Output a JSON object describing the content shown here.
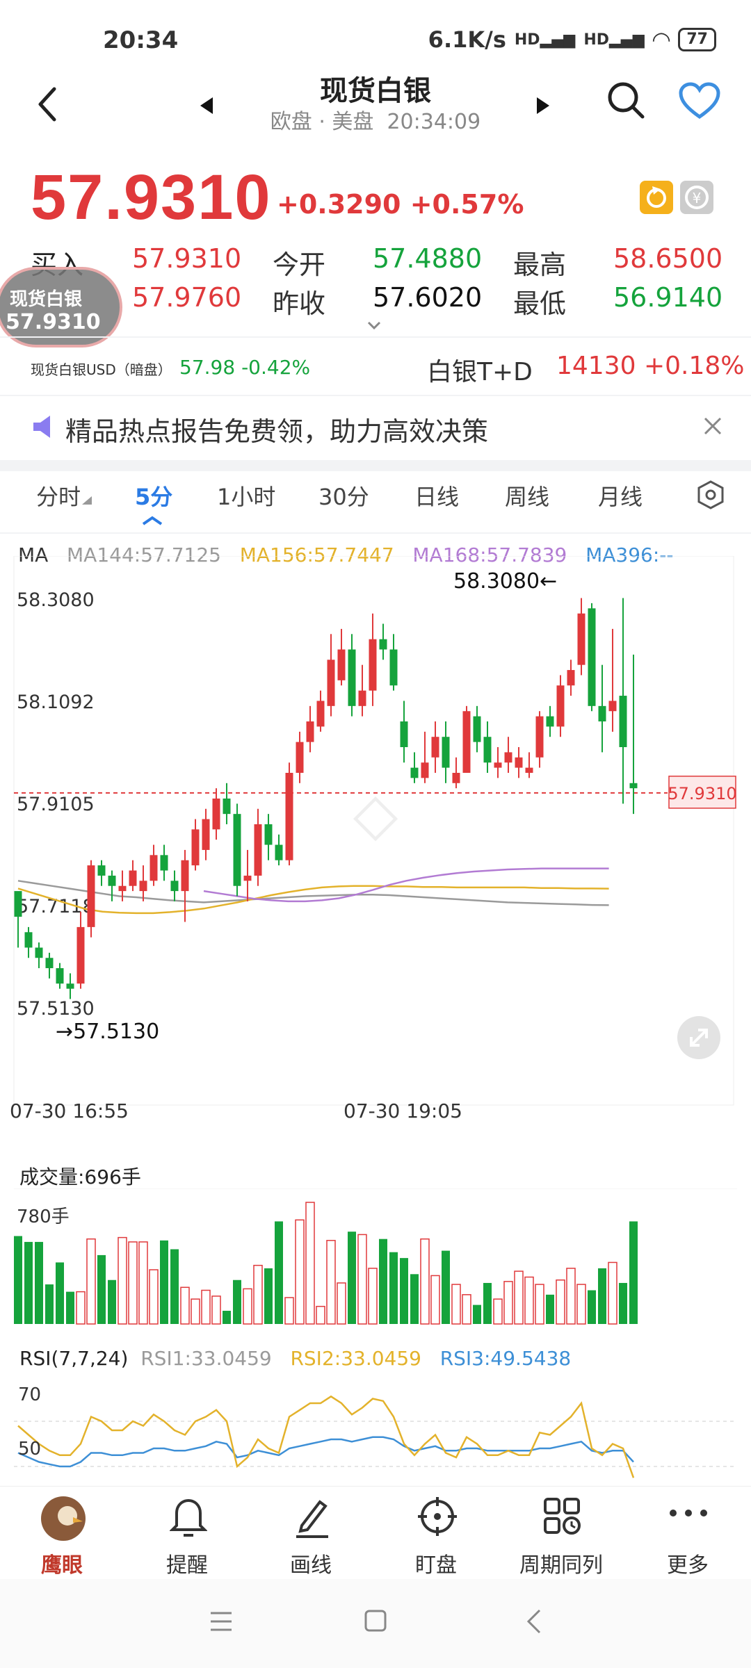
{
  "status": {
    "time": "20:34",
    "speed": "6.1K/s",
    "battery": "77"
  },
  "header": {
    "title": "现货白银",
    "subtitle": "欧盘 · 美盘",
    "clock": "20:34:09"
  },
  "quote": {
    "price": "57.9310",
    "change": "+0.3290",
    "change_pct": "+0.57%",
    "buy_label": "买入",
    "buy_value": "57.9310",
    "sell_value": "57.9760",
    "open_label": "今开",
    "open_value": "57.4880",
    "prev_label": "昨收",
    "prev_value": "57.6020",
    "high_label": "最高",
    "high_value": "58.6500",
    "low_label": "最低",
    "low_value": "56.9140",
    "float_name": "现货白银",
    "float_price": "57.9310"
  },
  "related": {
    "usd_label": "现货白银USD（暗盘）",
    "usd_value": "57.98",
    "usd_pct": "-0.42%",
    "td_label": "白银T+D",
    "td_value": "14130",
    "td_pct": "+0.18%"
  },
  "banner": {
    "text": "精品热点报告免费领，助力高效决策"
  },
  "tabs": [
    "分时",
    "5分",
    "1小时",
    "30分",
    "日线",
    "周线",
    "月线"
  ],
  "active_tab": "5分",
  "ma_legend": {
    "ma": "MA",
    "ma144": "MA144:57.7125",
    "ma156": "MA156:57.7447",
    "ma168": "MA168:57.7839",
    "ma396": "MA396:--"
  },
  "y_ticks": [
    "58.3080",
    "58.1092",
    "57.9105",
    "57.7118",
    "57.5130"
  ],
  "max_label": "58.3080",
  "min_label": "57.5130",
  "current_tag": "57.9310",
  "x_ticks": [
    "07-30 16:55",
    "07-30 19:05"
  ],
  "volume": {
    "label": "成交量:696手",
    "max": "780手"
  },
  "rsi": {
    "title": "RSI(7,7,24)",
    "rsi1": "RSI1:33.0459",
    "rsi2": "RSI2:33.0459",
    "rsi3": "RSI3:49.5438",
    "lv70": "70",
    "lv50": "50"
  },
  "bottom_nav": [
    "鹰眼",
    "提醒",
    "画线",
    "盯盘",
    "周期同列",
    "更多"
  ],
  "colors": {
    "up": "#e0393b",
    "down": "#15a33c",
    "ma144": "#9a9a9a",
    "ma156": "#e3b22b",
    "ma168": "#b27bd3",
    "ma396": "#3d8fd6",
    "accent": "#2b7be4"
  },
  "chart_data": {
    "type": "candlestick",
    "candles": [
      [
        57.74,
        57.69,
        57.71,
        57.63
      ],
      [
        57.66,
        57.63,
        57.67,
        57.61
      ],
      [
        57.63,
        57.61,
        57.64,
        57.59
      ],
      [
        57.61,
        57.59,
        57.62,
        57.57
      ],
      [
        57.59,
        57.56,
        57.6,
        57.55
      ],
      [
        57.56,
        57.55,
        57.58,
        57.53
      ],
      [
        57.56,
        57.67,
        57.7,
        57.55
      ],
      [
        57.67,
        57.79,
        57.8,
        57.65
      ],
      [
        57.79,
        57.77,
        57.8,
        57.75
      ],
      [
        57.77,
        57.75,
        57.78,
        57.72
      ],
      [
        57.74,
        57.75,
        57.78,
        57.72
      ],
      [
        57.75,
        57.78,
        57.8,
        57.74
      ],
      [
        57.74,
        57.76,
        57.79,
        57.72
      ],
      [
        57.76,
        57.81,
        57.83,
        57.75
      ],
      [
        57.81,
        57.78,
        57.83,
        57.76
      ],
      [
        57.76,
        57.74,
        57.78,
        57.72
      ],
      [
        57.74,
        57.8,
        57.82,
        57.68
      ],
      [
        57.79,
        57.86,
        57.88,
        57.78
      ],
      [
        57.82,
        57.88,
        57.9,
        57.8
      ],
      [
        57.86,
        57.92,
        57.94,
        57.84
      ],
      [
        57.92,
        57.89,
        57.95,
        57.87
      ],
      [
        57.89,
        57.75,
        57.91,
        57.73
      ],
      [
        57.76,
        57.77,
        57.82,
        57.72
      ],
      [
        57.77,
        57.87,
        57.9,
        57.75
      ],
      [
        57.87,
        57.83,
        57.89,
        57.8
      ],
      [
        57.83,
        57.8,
        57.85,
        57.79
      ],
      [
        57.8,
        57.97,
        57.99,
        57.79
      ],
      [
        57.97,
        58.03,
        58.05,
        57.95
      ],
      [
        58.03,
        58.07,
        58.1,
        58.01
      ],
      [
        58.06,
        58.11,
        58.13,
        58.05
      ],
      [
        58.1,
        58.19,
        58.24,
        58.08
      ],
      [
        58.15,
        58.21,
        58.25,
        58.14
      ],
      [
        58.21,
        58.1,
        58.24,
        58.08
      ],
      [
        58.1,
        58.13,
        58.18,
        58.08
      ],
      [
        58.13,
        58.23,
        58.28,
        58.1
      ],
      [
        58.23,
        58.21,
        58.26,
        58.19
      ],
      [
        58.21,
        58.14,
        58.24,
        58.13
      ],
      [
        58.07,
        58.02,
        58.11,
        57.99
      ],
      [
        57.98,
        57.96,
        58.01,
        57.95
      ],
      [
        57.96,
        57.99,
        58.05,
        57.95
      ],
      [
        58.0,
        58.04,
        58.07,
        57.97
      ],
      [
        58.04,
        57.98,
        58.07,
        57.95
      ],
      [
        57.95,
        57.97,
        58.0,
        57.94
      ],
      [
        57.97,
        58.09,
        58.1,
        57.97
      ],
      [
        58.08,
        58.03,
        58.1,
        58.01
      ],
      [
        58.04,
        57.99,
        58.07,
        57.97
      ],
      [
        57.98,
        57.99,
        58.02,
        57.96
      ],
      [
        57.99,
        58.01,
        58.04,
        57.97
      ],
      [
        57.98,
        58.0,
        58.02,
        57.96
      ],
      [
        57.97,
        57.98,
        58.01,
        57.96
      ],
      [
        58.0,
        58.08,
        58.09,
        57.98
      ],
      [
        58.08,
        58.06,
        58.1,
        58.04
      ],
      [
        58.06,
        58.14,
        58.16,
        58.04
      ],
      [
        58.14,
        58.17,
        58.19,
        58.12
      ],
      [
        58.18,
        58.28,
        58.31,
        58.16
      ],
      [
        58.29,
        58.1,
        58.3,
        58.09
      ],
      [
        58.1,
        58.07,
        58.18,
        58.01
      ],
      [
        58.09,
        58.11,
        58.25,
        58.05
      ],
      [
        58.12,
        58.02,
        58.31,
        57.91
      ],
      [
        57.95,
        57.94,
        58.2,
        57.89
      ]
    ],
    "ma_series": [
      {
        "name": "MA144",
        "values": [
          57.76,
          57.755,
          57.75,
          57.745,
          57.74,
          57.735,
          57.73,
          57.728,
          57.725,
          57.722,
          57.72,
          57.718,
          57.72,
          57.722,
          57.724,
          57.726,
          57.728,
          57.73,
          57.731,
          57.732,
          57.733,
          57.733,
          57.732,
          57.73,
          57.728,
          57.726,
          57.724,
          57.722,
          57.72,
          57.718,
          57.717,
          57.716,
          57.715,
          57.714,
          57.713,
          57.7125
        ]
      },
      {
        "name": "MA156",
        "values": [
          57.745,
          57.735,
          57.725,
          57.715,
          57.705,
          57.7,
          57.698,
          57.697,
          57.697,
          57.699,
          57.702,
          57.706,
          57.712,
          57.718,
          57.725,
          57.732,
          57.738,
          57.743,
          57.747,
          57.749,
          57.75,
          57.75,
          57.749,
          57.749,
          57.748,
          57.748,
          57.747,
          57.747,
          57.747,
          57.747,
          57.747,
          57.746,
          57.746,
          57.745,
          57.745,
          57.7447
        ]
      },
      {
        "name": "MA168",
        "values": [
          null,
          null,
          null,
          null,
          null,
          null,
          null,
          null,
          null,
          null,
          null,
          57.74,
          57.735,
          57.73,
          57.725,
          57.722,
          57.72,
          57.72,
          57.722,
          57.726,
          57.733,
          57.742,
          57.752,
          57.76,
          57.766,
          57.771,
          57.775,
          57.778,
          57.78,
          57.782,
          57.783,
          57.784,
          57.784,
          57.784,
          57.784,
          57.7839
        ]
      }
    ],
    "volume": [
      600,
      560,
      560,
      270,
      420,
      220,
      220,
      580,
      470,
      300,
      590,
      560,
      560,
      370,
      570,
      510,
      250,
      170,
      230,
      190,
      90,
      300,
      240,
      400,
      380,
      700,
      180,
      710,
      830,
      120,
      570,
      280,
      630,
      610,
      380,
      580,
      490,
      450,
      340,
      580,
      330,
      500,
      270,
      200,
      130,
      280,
      170,
      290,
      360,
      320,
      270,
      200,
      300,
      380,
      270,
      230,
      380,
      420,
      280,
      700
    ],
    "rsi": {
      "rsi1": [
        68,
        64,
        60,
        57,
        55,
        55,
        60,
        72,
        70,
        66,
        66,
        70,
        68,
        73,
        70,
        66,
        64,
        70,
        72,
        75,
        70,
        50,
        54,
        62,
        58,
        56,
        72,
        75,
        78,
        78,
        81,
        78,
        73,
        76,
        80,
        79,
        72,
        60,
        55,
        60,
        64,
        56,
        54,
        63,
        60,
        55,
        55,
        57,
        55,
        55,
        65,
        64,
        68,
        72,
        78,
        58,
        55,
        60,
        58,
        45
      ],
      "rsi2": [
        68,
        64,
        60,
        57,
        55,
        55,
        60,
        72,
        70,
        66,
        66,
        70,
        68,
        73,
        70,
        66,
        64,
        70,
        72,
        75,
        70,
        50,
        54,
        62,
        58,
        56,
        72,
        75,
        78,
        78,
        81,
        78,
        73,
        76,
        80,
        79,
        72,
        60,
        55,
        60,
        64,
        56,
        54,
        63,
        60,
        55,
        55,
        57,
        55,
        55,
        65,
        64,
        68,
        72,
        78,
        58,
        55,
        60,
        58,
        45
      ],
      "rsi3": [
        56,
        54,
        52,
        51,
        50,
        50,
        52,
        56,
        56,
        55,
        55,
        56,
        56,
        58,
        58,
        57,
        57,
        58,
        59,
        61,
        60,
        54,
        55,
        57,
        56,
        55,
        58,
        59,
        60,
        61,
        62,
        62,
        61,
        62,
        63,
        63,
        62,
        59,
        57,
        58,
        59,
        57,
        57,
        58,
        58,
        57,
        57,
        57,
        57,
        57,
        58,
        58,
        59,
        60,
        61,
        57,
        56,
        57,
        57,
        52
      ]
    }
  }
}
